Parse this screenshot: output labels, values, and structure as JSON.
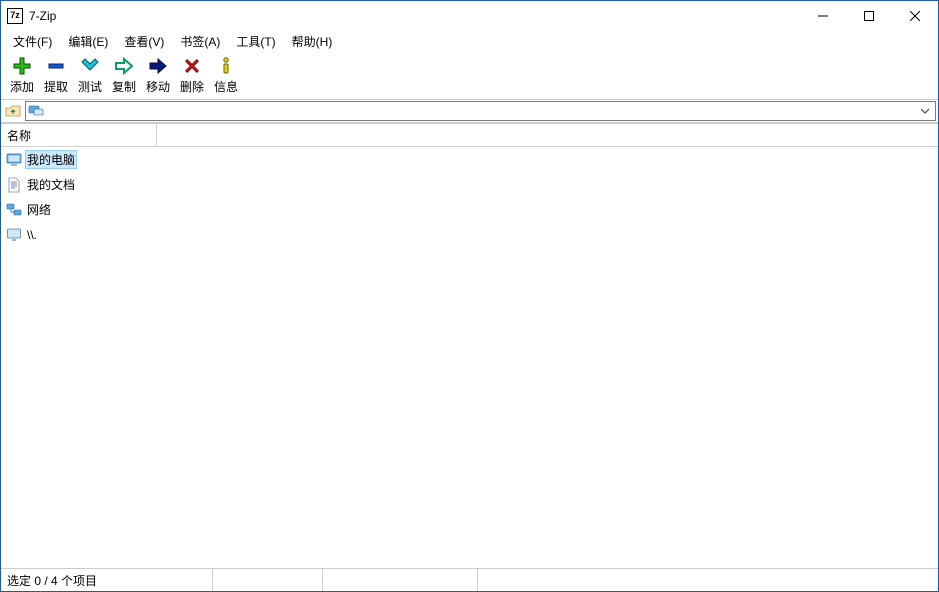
{
  "titlebar": {
    "title": "7-Zip",
    "app_icon_text": "7z"
  },
  "menu": {
    "file": "文件(F)",
    "edit": "编辑(E)",
    "view": "查看(V)",
    "bookmarks": "书签(A)",
    "tools": "工具(T)",
    "help": "帮助(H)"
  },
  "toolbar": {
    "add": "添加",
    "extract": "提取",
    "test": "测试",
    "copy": "复制",
    "move": "移动",
    "delete": "删除",
    "info": "信息"
  },
  "addressbar": {
    "path": ""
  },
  "listview": {
    "columns": {
      "name": "名称"
    },
    "items": [
      {
        "icon": "computer",
        "label": "我的电脑",
        "selected": true
      },
      {
        "icon": "document",
        "label": "我的文档",
        "selected": false
      },
      {
        "icon": "network",
        "label": "网络",
        "selected": false
      },
      {
        "icon": "monitor",
        "label": "\\\\.",
        "selected": false
      }
    ]
  },
  "statusbar": {
    "selection": "选定 0 / 4 个项目"
  }
}
